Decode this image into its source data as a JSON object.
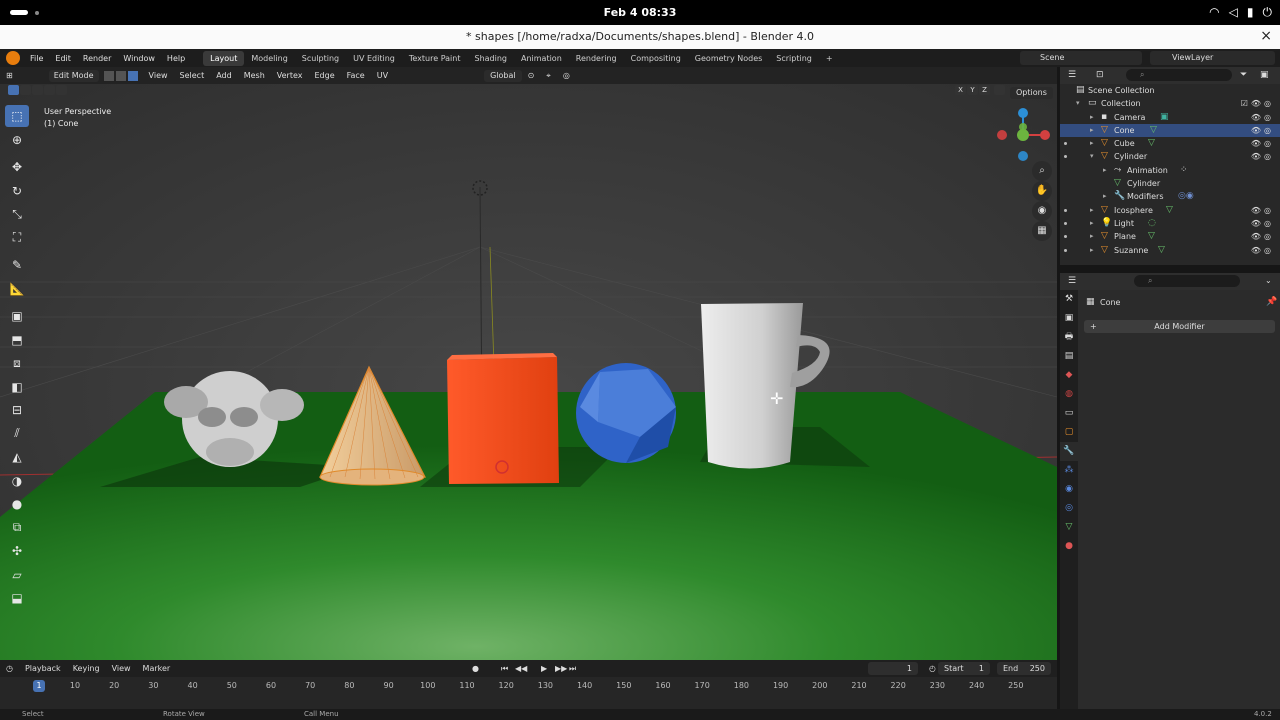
{
  "system": {
    "clock": "Feb 4  08:33"
  },
  "window": {
    "title": "* shapes [/home/radxa/Documents/shapes.blend] - Blender 4.0",
    "close_icon": "×"
  },
  "menu": {
    "file": "File",
    "edit": "Edit",
    "render": "Render",
    "window": "Window",
    "help": "Help"
  },
  "workspaces": [
    "Layout",
    "Modeling",
    "Sculpting",
    "UV Editing",
    "Texture Paint",
    "Shading",
    "Animation",
    "Rendering",
    "Compositing",
    "Geometry Nodes",
    "Scripting"
  ],
  "scene_name": "Scene",
  "view_layer": "ViewLayer",
  "viewport": {
    "mode": "Edit Mode",
    "menus": [
      "View",
      "Select",
      "Add",
      "Mesh",
      "Vertex",
      "Edge",
      "Face",
      "UV"
    ],
    "orientation": "Global",
    "options": "Options",
    "perspective": "User Perspective",
    "active_object": "(1) Cone",
    "axis_labels": {
      "x": "X",
      "y": "Y",
      "z": "Z"
    }
  },
  "timeline": {
    "menus": [
      "Playback",
      "Keying",
      "View",
      "Marker"
    ],
    "current_frame": "1",
    "start_label": "Start",
    "start": "1",
    "end_label": "End",
    "end": "250",
    "playhead": "1",
    "ticks": [
      "10",
      "20",
      "30",
      "40",
      "50",
      "60",
      "70",
      "80",
      "90",
      "100",
      "110",
      "120",
      "130",
      "140",
      "150",
      "160",
      "170",
      "180",
      "190",
      "200",
      "210",
      "220",
      "230",
      "240",
      "250"
    ]
  },
  "status": {
    "select": "Select",
    "rotate": "Rotate View",
    "menu": "Call Menu",
    "version": "4.0.2"
  },
  "outliner": {
    "root": "Scene Collection",
    "collection": "Collection",
    "items": [
      {
        "label": "Camera",
        "icon": "camera-icon",
        "selected": false
      },
      {
        "label": "Cone",
        "icon": "mesh-icon",
        "selected": true
      },
      {
        "label": "Cube",
        "icon": "mesh-icon",
        "selected": false
      },
      {
        "label": "Cylinder",
        "icon": "mesh-icon",
        "selected": false
      },
      {
        "label": "Animation",
        "icon": "animation-icon",
        "selected": false
      },
      {
        "label": "Cylinder",
        "icon": "mesh-data-icon",
        "selected": false
      },
      {
        "label": "Modifiers",
        "icon": "wrench-icon",
        "selected": false
      },
      {
        "label": "Icosphere",
        "icon": "mesh-icon",
        "selected": false
      },
      {
        "label": "Light",
        "icon": "light-icon",
        "selected": false
      },
      {
        "label": "Plane",
        "icon": "mesh-icon",
        "selected": false
      },
      {
        "label": "Suzanne",
        "icon": "mesh-icon",
        "selected": false
      }
    ]
  },
  "properties": {
    "object_name": "Cone",
    "add_modifier": "Add Modifier"
  },
  "colors": {
    "accent": "#4772b3",
    "selected_row": "#334d80",
    "object_orange": "#e8912d"
  }
}
